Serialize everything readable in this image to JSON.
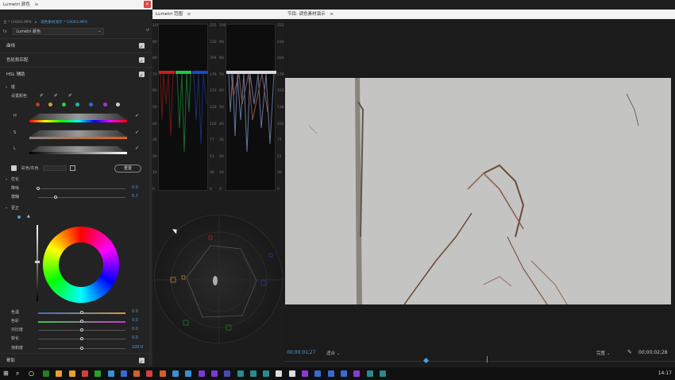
{
  "window": {
    "title": "Lumetri 颜色"
  },
  "lumetri": {
    "header": "Lumetri 颜色",
    "source_prefix": "主 * C0093.MP4",
    "source_link": "调色素材演示 * C0093.MP4",
    "fx_label": "fx",
    "fx_dropdown": "Lumetri 颜色",
    "reset_icon": "reset-icon",
    "sections": [
      "曲线",
      "色轮和匹配",
      "HSL 辅助"
    ],
    "key_label": "键",
    "set_color_label": "设置颜色",
    "hsl_letters": [
      "H",
      "S",
      "L"
    ],
    "color_gray_label": "彩色/灰色",
    "reset_label": "重置",
    "refine_label": "优化",
    "denoise_label": "降噪",
    "denoise_value": "0.0",
    "blur_label": "模糊",
    "blur_value": "5.7",
    "correction_label": "更正",
    "sliders": [
      {
        "label": "色温",
        "value": "0.0"
      },
      {
        "label": "色彩",
        "value": "0.0"
      },
      {
        "label": "对比度",
        "value": "0.0"
      },
      {
        "label": "锐化",
        "value": "0.0"
      },
      {
        "label": "饱和度",
        "value": "100.0"
      }
    ],
    "vignette_label": "晕影",
    "swatch_colors": [
      "#c0392b",
      "#c8a52a",
      "#2ecc40",
      "#1abc9c",
      "#2c6bd6",
      "#a03ac8",
      "#cfcfcf"
    ]
  },
  "scopes": {
    "header": "Lumetri 范围",
    "scale": [
      "255",
      "230",
      "204",
      "179",
      "153",
      "128",
      "102",
      "77",
      "51",
      "26",
      "0"
    ],
    "scale_left": [
      "100",
      "90",
      "80",
      "70",
      "60",
      "50",
      "40",
      "30",
      "20",
      "10",
      "0"
    ]
  },
  "program": {
    "header": "节目: 调色素材演示",
    "timecode_current": "00;00;01;27",
    "fit_label": "适合",
    "quality_label": "完整",
    "timecode_total": "00;00;02;28"
  },
  "taskbar": {
    "clock": "14:17"
  },
  "colors": {
    "accent": "#4f9edb",
    "close": "#e04343"
  }
}
